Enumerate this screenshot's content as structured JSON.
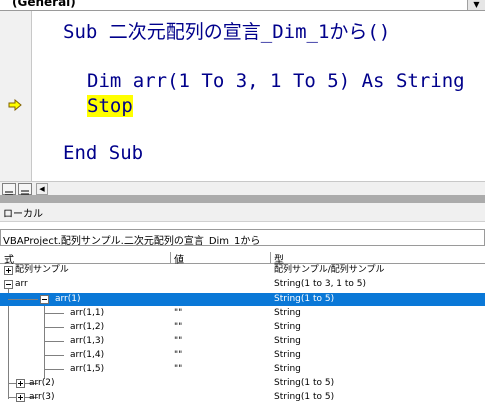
{
  "combo": {
    "text": "(General)",
    "arrow": "▼"
  },
  "code": {
    "line1": {
      "keyword": "Sub",
      "rest": " 二次元配列の宣言_Dim_1から()"
    },
    "line2": {
      "kw1": "Dim",
      "mid1": " arr(1 ",
      "kw2": "To",
      "mid2": " 3, 1 ",
      "kw3": "To",
      "mid3": " 5) ",
      "kw4": "As",
      "sp": " ",
      "kw5": "String"
    },
    "line3": {
      "keyword": "Stop"
    },
    "line4": {
      "keyword": "End Sub"
    },
    "current_line_indicator_color": "#ffff00"
  },
  "locals": {
    "title": "ローカル",
    "context": "VBAProject.配列サンプル.二次元配列の宣言_Dim_1から",
    "headers": {
      "expression": "式",
      "value": "値",
      "type": "型"
    },
    "rows": [
      {
        "expr": "配列サンプル",
        "value": "",
        "type": "配列サンプル/配列サンプル"
      },
      {
        "expr": "arr",
        "value": "",
        "type": "String(1 to 3, 1 to 5)"
      },
      {
        "expr": "arr(1)",
        "value": "",
        "type": "String(1 to 5)"
      },
      {
        "expr": "arr(1,1)",
        "value": "\"\"",
        "type": "String"
      },
      {
        "expr": "arr(1,2)",
        "value": "\"\"",
        "type": "String"
      },
      {
        "expr": "arr(1,3)",
        "value": "\"\"",
        "type": "String"
      },
      {
        "expr": "arr(1,4)",
        "value": "\"\"",
        "type": "String"
      },
      {
        "expr": "arr(1,5)",
        "value": "\"\"",
        "type": "String"
      },
      {
        "expr": "arr(2)",
        "value": "",
        "type": "String(1 to 5)"
      },
      {
        "expr": "arr(3)",
        "value": "",
        "type": "String(1 to 5)"
      }
    ],
    "selection_color": "#0a78d7"
  },
  "icons": {
    "execution_arrow": "yellow-arrow-icon",
    "procedure_view": "procedure-view-icon",
    "full_module_view": "full-module-view-icon"
  }
}
